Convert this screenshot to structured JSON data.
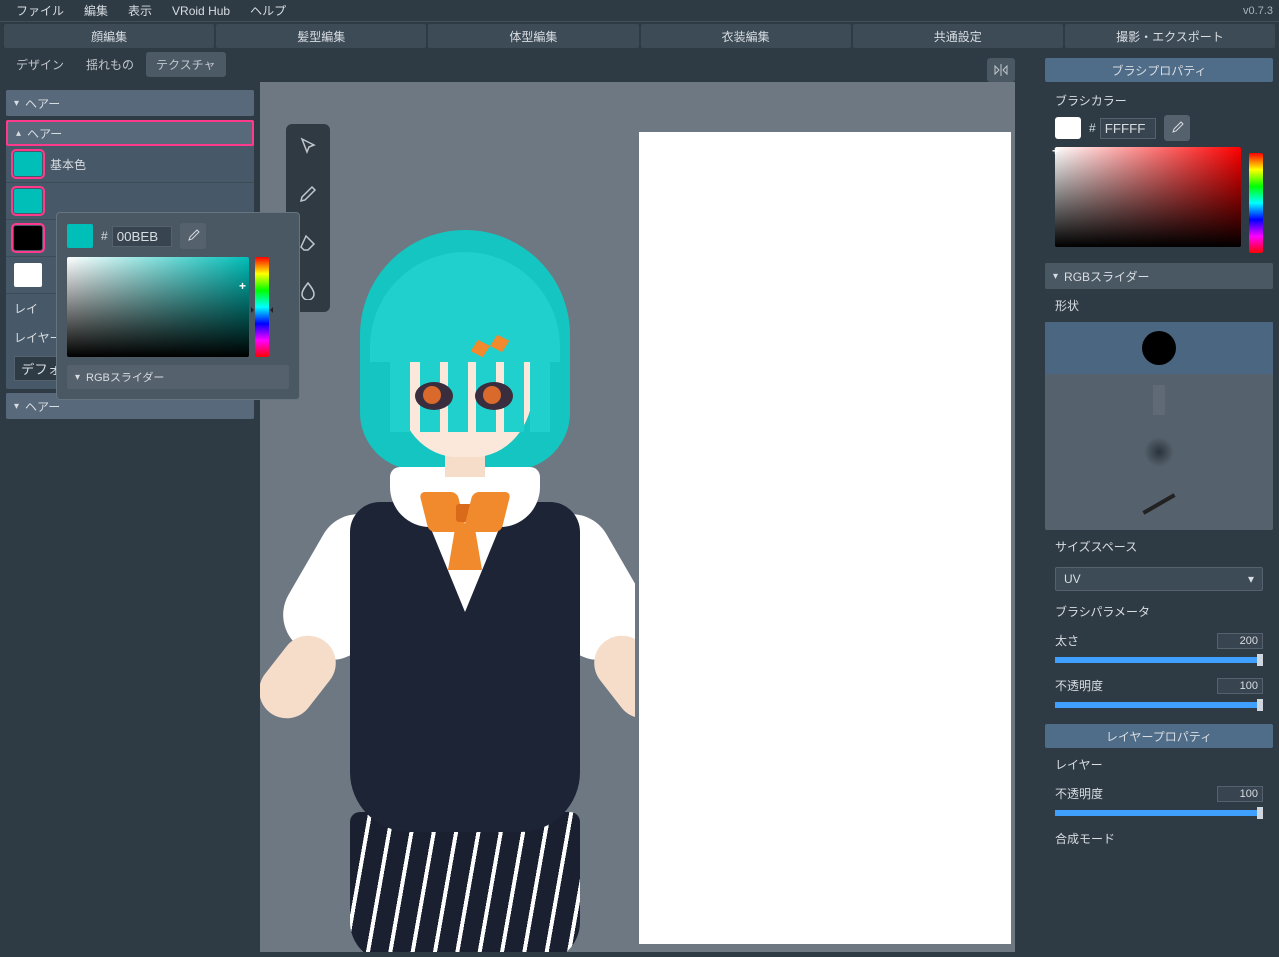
{
  "app": {
    "version": "v0.7.3"
  },
  "menu": {
    "file": "ファイル",
    "edit": "編集",
    "view": "表示",
    "hub": "VRoid Hub",
    "help": "ヘルプ"
  },
  "cats": {
    "face": "顔編集",
    "hair": "髪型編集",
    "body": "体型編集",
    "clothes": "衣装編集",
    "common": "共通設定",
    "export": "撮影・エクスポート"
  },
  "subtabs": {
    "design": "デザイン",
    "sway": "揺れもの",
    "texture": "テクスチャ"
  },
  "left": {
    "hair": "ヘアー",
    "base_color": "基本色",
    "hex_prefix": "#",
    "hex_value": "00BEB",
    "rgb_slider": "RGBスライダー",
    "layer": "レイヤー",
    "layer_name": "デフォルト画像",
    "layer_short": "レイ"
  },
  "brush": {
    "title": "ブラシプロパティ",
    "brush_color": "ブラシカラー",
    "hex_prefix": "#",
    "hex_value": "FFFFF",
    "rgb_slider": "RGBスライダー",
    "shape": "形状",
    "size_space": "サイズスペース",
    "size_space_value": "UV",
    "params": "ブラシパラメータ",
    "thickness": "太さ",
    "thickness_value": "200",
    "opacity": "不透明度",
    "opacity_value": "100"
  },
  "layerprop": {
    "title": "レイヤープロパティ",
    "layer": "レイヤー",
    "opacity": "不透明度",
    "opacity_value": "100",
    "blend": "合成モード"
  },
  "colors": {
    "teal": "#00beb8",
    "highlight": "#ff3a8c"
  }
}
